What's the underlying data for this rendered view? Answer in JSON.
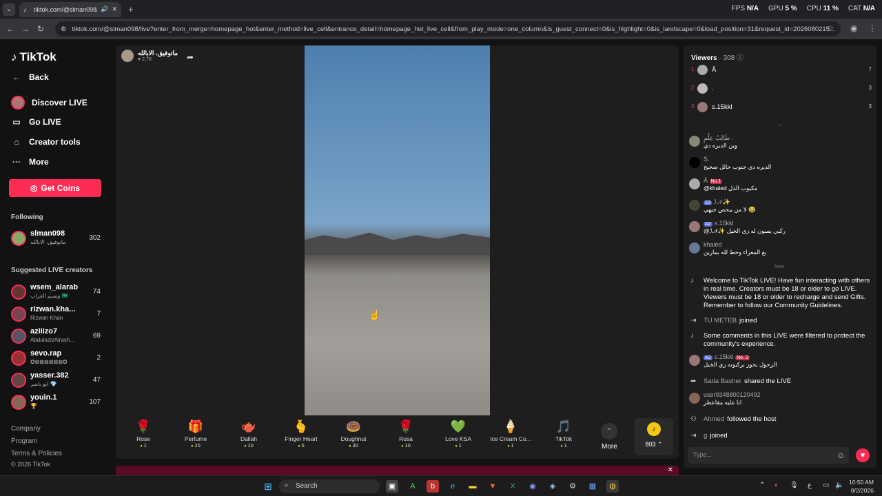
{
  "browser": {
    "tab_title": "tiktok.com/@slman098/live",
    "url": "tiktok.com/@slman098/live?enter_from_merge=homepage_hot&enter_method=live_cell&entrance_detail=homepage_hot_live_cell&from_play_mode=one_column&is_guest_connect=0&is_highlight=0&is_landscape=0&load_position=31&request_id=2026080215...",
    "stats": [
      {
        "label": "FPS",
        "value": "N/A"
      },
      {
        "label": "GPU",
        "value": "5 %"
      },
      {
        "label": "CPU",
        "value": "11 %"
      },
      {
        "label": "CAT",
        "value": "N/A"
      }
    ]
  },
  "sidebar": {
    "logo": "TikTok",
    "back": "Back",
    "links": [
      "Discover LIVE",
      "Go LIVE",
      "Creator tools",
      "More"
    ],
    "coins": "Get Coins",
    "following_title": "Following",
    "following": [
      {
        "name": "slman098",
        "sub": "ماتوفيق، الابالله",
        "count": "302"
      }
    ],
    "suggested_title": "Suggested LIVE creators",
    "suggested": [
      {
        "name": "wsem_alarab",
        "sub": "وسيم العراب 🇸🇦",
        "count": "74"
      },
      {
        "name": "rizwan.kha...",
        "sub": "Rizwan Khan",
        "count": "7"
      },
      {
        "name": "aziiizo7",
        "sub": "AbdulazizAlrash...",
        "count": "69"
      },
      {
        "name": "sevo.rap",
        "sub": "✪⊠⊠⊠⊠⊠⊠✪",
        "count": "2"
      },
      {
        "name": "yasser.382",
        "sub": "ابو ياسر 💎",
        "count": "47"
      },
      {
        "name": "youin.1",
        "sub": "🏆",
        "count": "107"
      }
    ],
    "footer": [
      "Company",
      "Program",
      "Terms & Policies",
      "© 2026 TikTok"
    ]
  },
  "player": {
    "host_name": "ماتوفيق، الابالله",
    "host_likes": "♥ 2.7K",
    "gifts": [
      {
        "name": "Rose",
        "price": "1",
        "icon": "🌹"
      },
      {
        "name": "Perfume",
        "price": "20",
        "icon": "🎁"
      },
      {
        "name": "Dallah",
        "price": "10",
        "icon": "🫖"
      },
      {
        "name": "Finger Heart",
        "price": "5",
        "icon": "🫰"
      },
      {
        "name": "Doughnut",
        "price": "30",
        "icon": "🍩"
      },
      {
        "name": "Rosa",
        "price": "10",
        "icon": "🌹"
      },
      {
        "name": "Love KSA",
        "price": "1",
        "icon": "💚"
      },
      {
        "name": "Ice Cream Co...",
        "price": "1",
        "icon": "🍦"
      },
      {
        "name": "TikTok",
        "price": "1",
        "icon": "🎵"
      }
    ],
    "more": "More",
    "balance": "803 ⌃"
  },
  "chat": {
    "viewers_label": "Viewers",
    "viewers_count": "· 308",
    "top": [
      {
        "rank": "1",
        "name": "Ä",
        "score": "7"
      },
      {
        "rank": "2",
        "name": ".",
        "score": "3"
      },
      {
        "rank": "3",
        "name": "s.15kkl",
        "score": "3"
      }
    ],
    "messages": [
      {
        "user": "طَالِبُ عِلْمٍ .",
        "text": "وين الديره دي"
      },
      {
        "user": "S.",
        "text": "الديره دي جنوب حائل صحيح"
      },
      {
        "user": "Ä",
        "badge": "No.1",
        "text": "@khaled مكيوب الذل"
      },
      {
        "user": "ℐ𝒩✨",
        "badge": "10",
        "text": "لا من يبحص جيهي 😂"
      },
      {
        "user": "s.15kkl",
        "badge": "A2",
        "text": "@ℐ𝒩✨ ركبي يسون له زي الخيل"
      },
      {
        "user": "khaled",
        "text": "بع المعزاء وحط لله بمارين"
      }
    ],
    "now": "Now",
    "welcome": "Welcome to TikTok LIVE! Have fun interacting with others in real time. Creators must be 18 or older to go LIVE. Viewers must be 18 or older to recharge and send Gifts. Remember to follow our Community Guidelines.",
    "joined1_user": "TU METEB",
    "joined1_text": "joined",
    "filtered": "Some comments in this LIVE were filtered to protect the community's experience.",
    "msg2_user": "s.15kkl",
    "msg2_badge": "No. 3",
    "msg2_text": "الرحول بحوز بركبونه زي الخيل",
    "share_user": "Sada Basher",
    "share_text": "shared the LIVE",
    "msg3_user": "user9348800120492",
    "msg3_text": "انا عليه مقاعطر",
    "follow_user": "Ahmed",
    "follow_text": "followed the host",
    "joined2_user": "g",
    "joined2_text": "joined",
    "placeholder": "Type..."
  },
  "taskbar": {
    "search": "Search",
    "time": "10:50 AM",
    "date": "8/2/2026",
    "lang": "ع"
  }
}
